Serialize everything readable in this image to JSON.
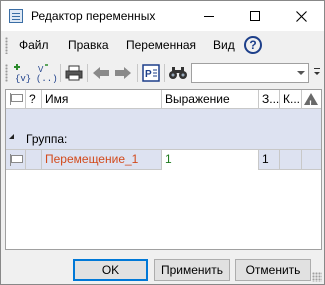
{
  "window": {
    "title": "Редактор переменных",
    "controls": {
      "minimize": "minimize-icon",
      "maximize": "maximize-icon",
      "close": "close-icon"
    }
  },
  "menu": {
    "items": [
      {
        "label": "Файл"
      },
      {
        "label": "Правка"
      },
      {
        "label": "Переменная"
      },
      {
        "label": "Вид"
      }
    ],
    "help_glyph": "?"
  },
  "toolbar": {
    "buttons": [
      "add-variable-icon",
      "add-expression-icon",
      "print-icon",
      "undo-icon",
      "redo-icon",
      "properties-icon",
      "find-icon"
    ],
    "search_value": ""
  },
  "grid": {
    "columns": [
      {
        "label": "",
        "icon": "flag-icon"
      },
      {
        "label": "?"
      },
      {
        "label": "Имя"
      },
      {
        "label": "Выражение"
      },
      {
        "label": "З..."
      },
      {
        "label": "К..."
      },
      {
        "label": "",
        "icon": "warning-icon"
      }
    ],
    "group": {
      "label": "Группа:"
    },
    "rows": [
      {
        "name": "Перемещение_1",
        "expression": "1",
        "value": "1",
        "comment": ""
      }
    ],
    "colors": {
      "selection": "#dde2f1",
      "name": "#d24a1c",
      "expression": "#1e7a1e"
    }
  },
  "buttons": {
    "ok": "OK",
    "apply": "Применить",
    "cancel": "Отменить"
  }
}
